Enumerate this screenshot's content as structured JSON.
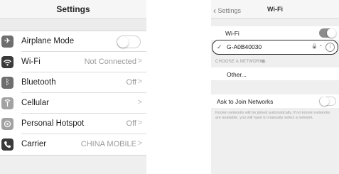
{
  "settings": {
    "title": "Settings",
    "rows": [
      {
        "label": "Airplane Mode",
        "value": "",
        "icon": "airplane-icon"
      },
      {
        "label": "Wi-Fi",
        "value": "Not Connected",
        "icon": "wifi-icon"
      },
      {
        "label": "Bluetooth",
        "value": "Off",
        "icon": "bluetooth-icon"
      },
      {
        "label": "Cellular",
        "value": "",
        "icon": "cellular-icon"
      },
      {
        "label": "Personal Hotspot",
        "value": "Off",
        "icon": "hotspot-icon"
      },
      {
        "label": "Carrier",
        "value": "CHINA MOBILE",
        "icon": "phone-icon"
      }
    ],
    "airplane_mode_on": false
  },
  "wifi": {
    "back_label": "Settings",
    "title": "Wi-Fi",
    "wifi_label": "Wi-Fi",
    "wifi_on": true,
    "network_name": "G-A0B40030",
    "section_header": "CHOOSE A NETWORK...",
    "other_label": "Other...",
    "ask_label": "Ask to Join Networks",
    "ask_on": false,
    "note": "Known networks will be joined automatically. If no known networks are available, you will have to manually select a network."
  }
}
